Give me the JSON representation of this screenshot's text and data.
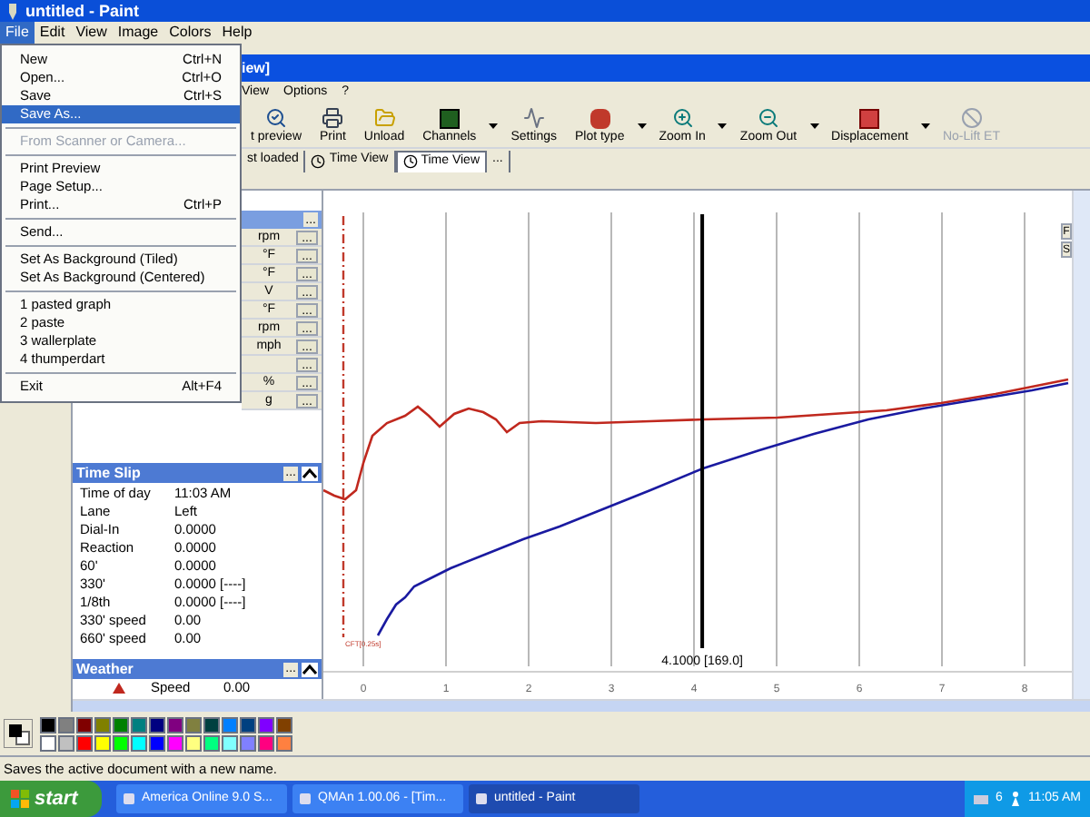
{
  "paint_window": {
    "title": "untitled - Paint",
    "menu": [
      {
        "label": "File",
        "selected": true
      },
      {
        "label": "Edit",
        "selected": false
      },
      {
        "label": "View",
        "selected": false
      },
      {
        "label": "Image",
        "selected": false
      },
      {
        "label": "Colors",
        "selected": false
      },
      {
        "label": "Help",
        "selected": false
      }
    ]
  },
  "file_menu": [
    {
      "kind": "item",
      "label": "New",
      "shortcut": "Ctrl+N",
      "selected": false,
      "disabled": false
    },
    {
      "kind": "item",
      "label": "Open...",
      "shortcut": "Ctrl+O",
      "selected": false,
      "disabled": false
    },
    {
      "kind": "item",
      "label": "Save",
      "shortcut": "Ctrl+S",
      "selected": false,
      "disabled": false
    },
    {
      "kind": "item",
      "label": "Save As...",
      "selected": true,
      "disabled": false
    },
    {
      "kind": "separator"
    },
    {
      "kind": "item",
      "label": "From Scanner or Camera...",
      "selected": false,
      "disabled": true
    },
    {
      "kind": "separator"
    },
    {
      "kind": "item",
      "label": "Print Preview",
      "selected": false,
      "disabled": false
    },
    {
      "kind": "item",
      "label": "Page Setup...",
      "selected": false,
      "disabled": false
    },
    {
      "kind": "item",
      "label": "Print...",
      "shortcut": "Ctrl+P",
      "selected": false,
      "disabled": false
    },
    {
      "kind": "separator"
    },
    {
      "kind": "item",
      "label": "Send...",
      "selected": false,
      "disabled": false
    },
    {
      "kind": "separator"
    },
    {
      "kind": "item",
      "label": "Set As Background (Tiled)",
      "selected": false,
      "disabled": false
    },
    {
      "kind": "item",
      "label": "Set As Background (Centered)",
      "selected": false,
      "disabled": false
    },
    {
      "kind": "separator"
    },
    {
      "kind": "item",
      "label": "1 pasted graph",
      "selected": false,
      "disabled": false
    },
    {
      "kind": "item",
      "label": "2 paste",
      "selected": false,
      "disabled": false
    },
    {
      "kind": "item",
      "label": "3 wallerplate",
      "selected": false,
      "disabled": false
    },
    {
      "kind": "item",
      "label": "4 thumperdart",
      "selected": false,
      "disabled": false
    },
    {
      "kind": "separator"
    },
    {
      "kind": "item",
      "label": "Exit",
      "shortcut": "Alt+F4",
      "selected": false,
      "disabled": false
    }
  ],
  "qman": {
    "title": "iew]",
    "menu": [
      "View",
      "Options",
      "?"
    ],
    "toolbar": [
      {
        "kind": "preview",
        "label": "t preview",
        "dropdown": false,
        "disabled": false
      },
      {
        "kind": "print",
        "label": "Print",
        "dropdown": false,
        "disabled": false
      },
      {
        "kind": "unload",
        "label": "Unload",
        "dropdown": false,
        "disabled": false
      },
      {
        "kind": "channels",
        "label": "Channels",
        "dropdown": true,
        "disabled": false
      },
      {
        "kind": "settings",
        "label": "Settings",
        "dropdown": false,
        "disabled": false
      },
      {
        "kind": "plot",
        "label": "Plot type",
        "dropdown": true,
        "disabled": false
      },
      {
        "kind": "zoomin",
        "label": "Zoom In",
        "dropdown": true,
        "disabled": false
      },
      {
        "kind": "zoomout",
        "label": "Zoom Out",
        "dropdown": true,
        "disabled": false
      },
      {
        "kind": "displacement",
        "label": "Displacement",
        "dropdown": true,
        "disabled": false
      },
      {
        "kind": "nolift",
        "label": "No-Lift ET",
        "dropdown": false,
        "disabled": true
      }
    ],
    "tabs": [
      {
        "label": "st loaded",
        "clock": false,
        "selected": false
      },
      {
        "label": "Time View",
        "clock": true,
        "selected": false
      },
      {
        "label": "Time View",
        "clock": true,
        "selected": true
      },
      {
        "label": "...",
        "clock": false,
        "selected": false
      }
    ],
    "channels": {
      "header_button": "...",
      "rows": [
        {
          "unit": "rpm",
          "button": "..."
        },
        {
          "unit": "°F",
          "button": "..."
        },
        {
          "unit": "°F",
          "button": "..."
        },
        {
          "unit": "V",
          "button": "..."
        },
        {
          "unit": "°F",
          "button": "..."
        },
        {
          "unit": "rpm",
          "button": "..."
        },
        {
          "unit": "mph",
          "button": "..."
        },
        {
          "button": "..."
        },
        {
          "unit": "%",
          "button": "..."
        },
        {
          "unit": "g",
          "button": "..."
        }
      ]
    },
    "time_slip": {
      "title": "Time Slip",
      "button": "...",
      "rows": [
        {
          "label": "Time of day",
          "value": "11:03 AM"
        },
        {
          "label": "Lane",
          "value": "Left"
        },
        {
          "label": "Dial-In",
          "value": "0.0000"
        },
        {
          "label": "Reaction",
          "value": "0.0000"
        },
        {
          "label": "60'",
          "value": "0.0000"
        },
        {
          "label": "330'",
          "value": "0.0000 [----]"
        },
        {
          "label": "1/8th",
          "value": "0.0000 [----]"
        },
        {
          "label": "330' speed",
          "value": "0.00"
        },
        {
          "label": "660' speed",
          "value": "0.00"
        }
      ]
    },
    "weather": {
      "title": "Weather",
      "button": "...",
      "rows": [
        {
          "label": "Speed",
          "value": "0.00"
        }
      ]
    },
    "chart": {
      "x_tick_labels": [
        "0",
        "1",
        "2",
        "3",
        "4",
        "5",
        "6",
        "7",
        "8"
      ],
      "cursor_label": "4.1000 [169.0]",
      "marker_label": "CFT[0.25s]",
      "side_buttons": [
        "F",
        "S"
      ]
    }
  },
  "palette": [
    {
      "color": "#000000"
    },
    {
      "color": "#808080"
    },
    {
      "color": "#800000"
    },
    {
      "color": "#808000"
    },
    {
      "color": "#008000"
    },
    {
      "color": "#008080"
    },
    {
      "color": "#000080"
    },
    {
      "color": "#800080"
    },
    {
      "color": "#808040"
    },
    {
      "color": "#004040"
    },
    {
      "color": "#0080ff"
    },
    {
      "color": "#004080"
    },
    {
      "color": "#8000ff"
    },
    {
      "color": "#804000"
    },
    {
      "color": "#ffffff"
    },
    {
      "color": "#c0c0c0"
    },
    {
      "color": "#ff0000"
    },
    {
      "color": "#ffff00"
    },
    {
      "color": "#00ff00"
    },
    {
      "color": "#00ffff"
    },
    {
      "color": "#0000ff"
    },
    {
      "color": "#ff00ff"
    },
    {
      "color": "#ffff80"
    },
    {
      "color": "#00ff80"
    },
    {
      "color": "#80ffff"
    },
    {
      "color": "#8080ff"
    },
    {
      "color": "#ff0080"
    },
    {
      "color": "#ff8040"
    }
  ],
  "status_bar": "Saves the active document with a new name.",
  "taskbar": {
    "start": "start",
    "buttons": [
      {
        "label": "America Online 9.0 S...",
        "selected": false
      },
      {
        "label": "QMAn 1.00.06 - [Tim...",
        "selected": false
      },
      {
        "label": "untitled - Paint",
        "selected": true
      }
    ],
    "tray_count": "6",
    "clock": "11:05 AM"
  }
}
